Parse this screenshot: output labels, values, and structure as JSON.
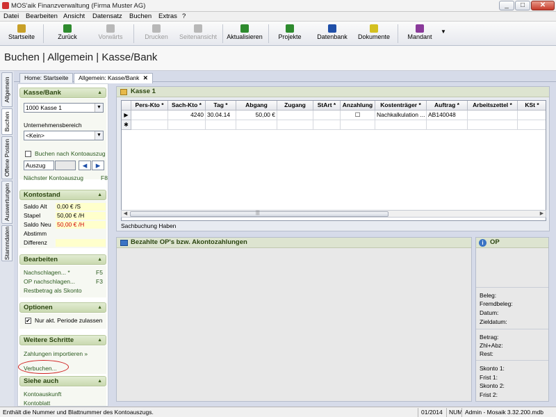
{
  "window": {
    "title": "MOS'aik Finanzverwaltung (Firma Muster AG)",
    "minimize": "_",
    "maximize": "□",
    "close": "✕"
  },
  "menu": [
    "Datei",
    "Bearbeiten",
    "Ansicht",
    "Datensatz",
    "Buchen",
    "Extras",
    "?"
  ],
  "toolbar": [
    {
      "label": "Startseite",
      "icon": "home-icon",
      "color": "#c8a028",
      "enabled": true
    },
    {
      "label": "Zurück",
      "icon": "back-arrow-icon",
      "color": "#2e8b2e",
      "enabled": true
    },
    {
      "label": "Vorwärts",
      "icon": "forward-arrow-icon",
      "color": "#a0a0a0",
      "enabled": false
    },
    {
      "label": "Drucken",
      "icon": "printer-icon",
      "color": "#a0a0a0",
      "enabled": false
    },
    {
      "label": "Seitenansicht",
      "icon": "page-preview-icon",
      "color": "#a0a0a0",
      "enabled": false
    },
    {
      "label": "Aktualisieren",
      "icon": "refresh-icon",
      "color": "#2e8b2e",
      "enabled": true
    },
    {
      "label": "Projekte",
      "icon": "projects-icon",
      "color": "#2e8b2e",
      "enabled": true
    },
    {
      "label": "Datenbank",
      "icon": "database-icon",
      "color": "#1f4fa8",
      "enabled": true
    },
    {
      "label": "Dokumente",
      "icon": "documents-icon",
      "color": "#d4c020",
      "enabled": true
    },
    {
      "label": "Mandant",
      "icon": "users-icon",
      "color": "#8a3a9a",
      "enabled": true
    }
  ],
  "page_title": "Buchen | Allgemein | Kasse/Bank",
  "vertical_tabs": [
    "Allgemein",
    "Buchen",
    "Offene Posten",
    "Auswertungen",
    "Stammdaten"
  ],
  "doc_tabs": {
    "home": "Home: Startseite",
    "active": "Allgemein: Kasse/Bank",
    "close": "✕"
  },
  "left_pane": {
    "kasse": {
      "title": "Kasse/Bank",
      "account_select": "1000 Kasse 1",
      "unit_label": "Unternehmensbereich",
      "unit_select": "<Kein>",
      "statement_checkbox_label": "Buchen nach Kontoauszug",
      "statement_field": "Auszug",
      "prev_arrow": "◀",
      "next_arrow": "▶",
      "next_statement": {
        "label": "Nächster Kontoauszug",
        "key": "F8"
      }
    },
    "kontostand": {
      "title": "Kontostand",
      "rows": [
        {
          "label": "Saldo Alt",
          "value": "0,00 € /S",
          "red": false
        },
        {
          "label": "Stapel",
          "value": "50,00 € /H",
          "red": false
        },
        {
          "label": "Saldo Neu",
          "value": "50,00 € /H",
          "red": true
        },
        {
          "label": "Abstimm",
          "value": "",
          "red": false
        },
        {
          "label": "Differenz",
          "value": "",
          "red": false
        }
      ]
    },
    "bearbeiten": {
      "title": "Bearbeiten",
      "items": [
        {
          "label": "Nachschlagen... *",
          "key": "F5"
        },
        {
          "label": "OP nachschlagen...",
          "key": "F3"
        },
        {
          "label": "Restbetrag als Skonto",
          "key": ""
        }
      ]
    },
    "optionen": {
      "title": "Optionen",
      "checkbox_label": "Nur akt. Periode zulassen",
      "checked": "✔"
    },
    "weitere": {
      "title": "Weitere Schritte",
      "items": [
        "Zahlungen importieren »",
        "Verbuchen..."
      ]
    },
    "siehe": {
      "title": "Siehe auch",
      "items": [
        "Kontoauskunft",
        "Kontoblatt"
      ]
    }
  },
  "grid": {
    "title": "Kasse 1",
    "columns": [
      "Pers-Kto *",
      "Sach-Kto *",
      "Tag *",
      "Abgang",
      "Zugang",
      "StArt *",
      "Anzahlung",
      "Kostenträger *",
      "Auftrag *",
      "Arbeitszettel *",
      "KSt *"
    ],
    "rows": [
      {
        "marker": "▶",
        "cells": [
          "",
          "4240",
          "30.04.14",
          "50,00 €",
          "",
          "",
          "☐",
          "Nachkalkulation ...",
          "AB140048",
          "",
          ""
        ]
      },
      {
        "marker": "✱",
        "cells": [
          "",
          "",
          "",
          "",
          "",
          "",
          "",
          "",
          "",
          "",
          ""
        ]
      }
    ],
    "status": "Sachbuchung Haben",
    "scroll_left": "◀",
    "scroll_right": "▶",
    "scroll_grip": "|||"
  },
  "op_panel": {
    "title": "Bezahlte OP's bzw. Akontozahlungen"
  },
  "info_panel": {
    "title": "OP",
    "icon_glyph": "i",
    "group1": [
      "Beleg:",
      "Fremdbeleg:",
      "Datum:",
      "Zieldatum:"
    ],
    "group2": [
      "Betrag:",
      "Zhl+Abz:",
      "Rest:"
    ],
    "group3": [
      "Skonto 1:",
      "Frist 1:",
      "Skonto 2:",
      "Frist 2:"
    ]
  },
  "statusbar": {
    "message": "Enthält die Nummer und Blattnummer des Kontoauszugs.",
    "period": "01/2014",
    "num": "NUM",
    "user_db": "Admin - Mosaik 3.32.200.mdb"
  }
}
